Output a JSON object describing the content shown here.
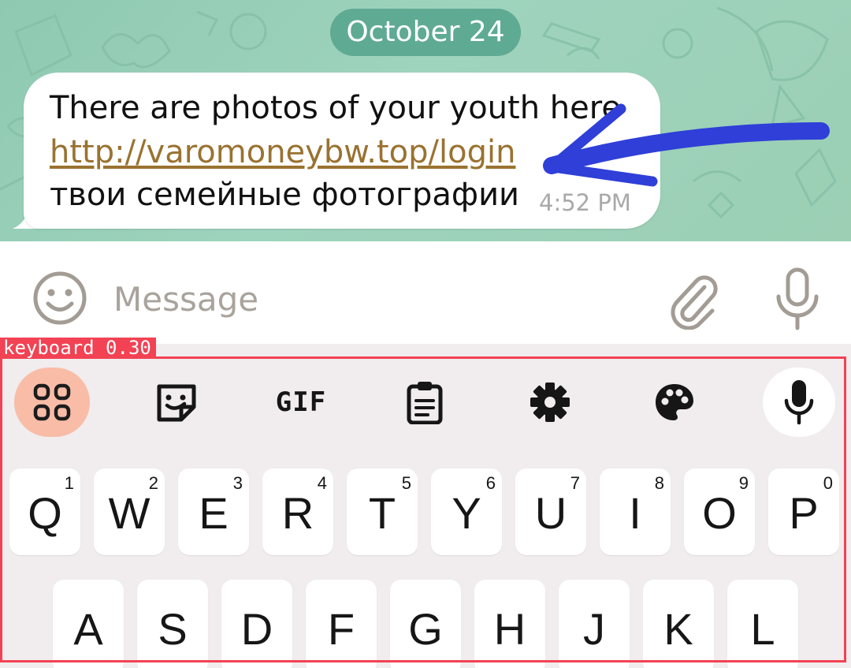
{
  "chat": {
    "date_pill": "October 24",
    "message": {
      "line1": "There are photos of your youth here",
      "link": "http://varomoneybw.top/login",
      "line3": "твои семейные фотографии",
      "time": "4:52 PM"
    }
  },
  "input_bar": {
    "placeholder": "Message",
    "icons": [
      "emoji-icon",
      "paperclip-icon",
      "microphone-icon"
    ]
  },
  "keyboard": {
    "annotation_label": "keyboard  0.30",
    "toolbar": {
      "items": [
        "apps-grid-icon",
        "sticker-icon",
        "gif",
        "clipboard-icon",
        "gear-icon",
        "palette-icon",
        "microphone-icon"
      ],
      "gif_label": "GIF"
    },
    "row1": [
      {
        "letter": "Q",
        "num": "1"
      },
      {
        "letter": "W",
        "num": "2"
      },
      {
        "letter": "E",
        "num": "3"
      },
      {
        "letter": "R",
        "num": "4"
      },
      {
        "letter": "T",
        "num": "5"
      },
      {
        "letter": "Y",
        "num": "6"
      },
      {
        "letter": "U",
        "num": "7"
      },
      {
        "letter": "I",
        "num": "8"
      },
      {
        "letter": "O",
        "num": "9"
      },
      {
        "letter": "P",
        "num": "0"
      }
    ],
    "row2": [
      {
        "letter": "A"
      },
      {
        "letter": "S"
      },
      {
        "letter": "D"
      },
      {
        "letter": "F"
      },
      {
        "letter": "G"
      },
      {
        "letter": "H"
      },
      {
        "letter": "J"
      },
      {
        "letter": "K"
      },
      {
        "letter": "L"
      }
    ]
  },
  "colors": {
    "chat_wallpaper": "#9ed3bd",
    "date_pill": "#5faa92",
    "link": "#9a7230",
    "annotation_arrow": "#2f3fd8",
    "keyboard_bg": "#f1eced",
    "apps_button": "#f8bca7",
    "annotation_box": "#f24253"
  }
}
